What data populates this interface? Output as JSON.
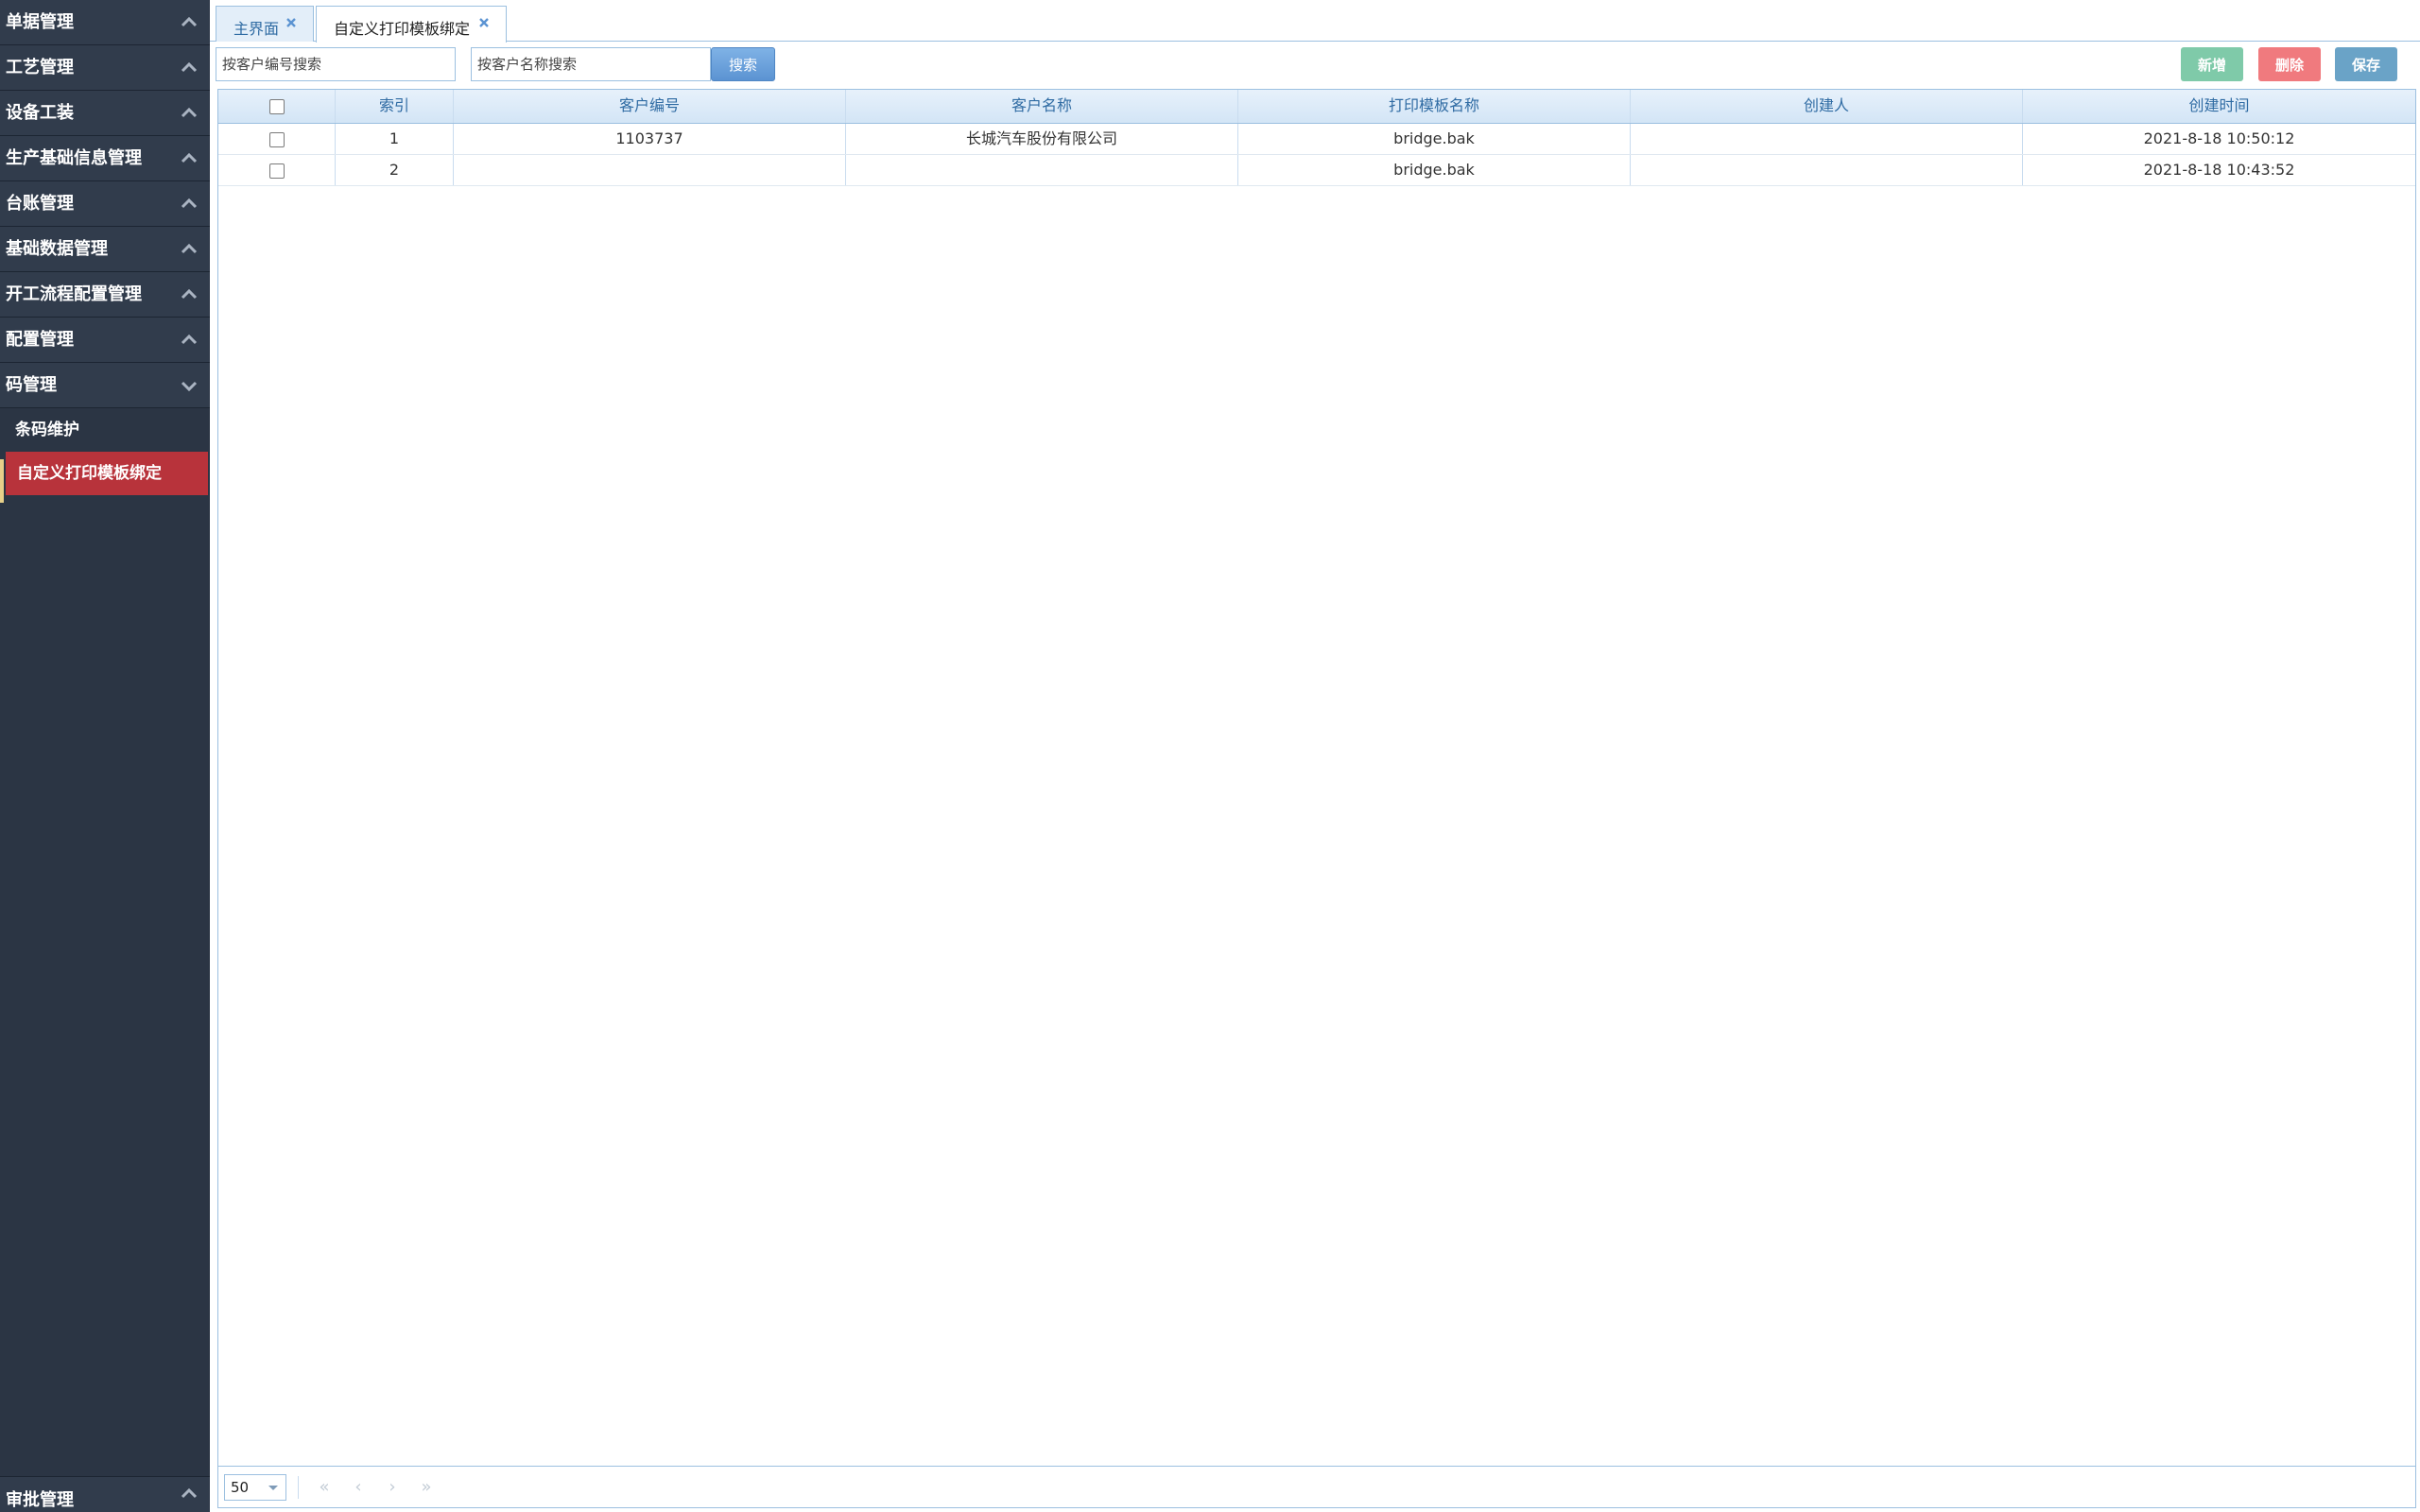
{
  "sidebar": {
    "groups": [
      {
        "label": "单据管理"
      },
      {
        "label": "工艺管理"
      },
      {
        "label": "设备工装"
      },
      {
        "label": "生产基础信息管理"
      },
      {
        "label": "台账管理"
      },
      {
        "label": "基础数据管理"
      },
      {
        "label": "开工流程配置管理"
      },
      {
        "label": "配置管理"
      },
      {
        "label": "码管理"
      }
    ],
    "subitems": [
      {
        "label": "条码维护"
      },
      {
        "label": "自定义打印模板绑定"
      }
    ],
    "bottom": {
      "label": "审批管理"
    }
  },
  "tabs": [
    {
      "label": "主界面"
    },
    {
      "label": "自定义打印模板绑定"
    }
  ],
  "toolbar": {
    "search_code_placeholder": "按客户编号搜索",
    "search_name_placeholder": "按客户名称搜索",
    "search_label": "搜索",
    "add_label": "新增",
    "delete_label": "删除",
    "save_label": "保存"
  },
  "table": {
    "headers": [
      "",
      "索引",
      "客户编号",
      "客户名称",
      "打印模板名称",
      "创建人",
      "创建时间"
    ],
    "rows": [
      {
        "index": "1",
        "customer_code": "1103737",
        "customer_name": "长城汽车股份有限公司",
        "template": "bridge.bak",
        "creator": "",
        "created_at": "2021-8-18 10:50:12"
      },
      {
        "index": "2",
        "customer_code": "",
        "customer_name": "",
        "template": "bridge.bak",
        "creator": "",
        "created_at": "2021-8-18 10:43:52"
      }
    ]
  },
  "pager": {
    "page_size": "50",
    "first": "«",
    "prev": "‹",
    "next": "›",
    "last": "»"
  },
  "colors": {
    "sidebar_bg": "#2b3544",
    "active_item": "#b8333b",
    "header_text": "#2f6ba3",
    "add_btn": "#7fcaa9",
    "delete_btn": "#f07a7e",
    "save_btn": "#6aa3c7"
  }
}
